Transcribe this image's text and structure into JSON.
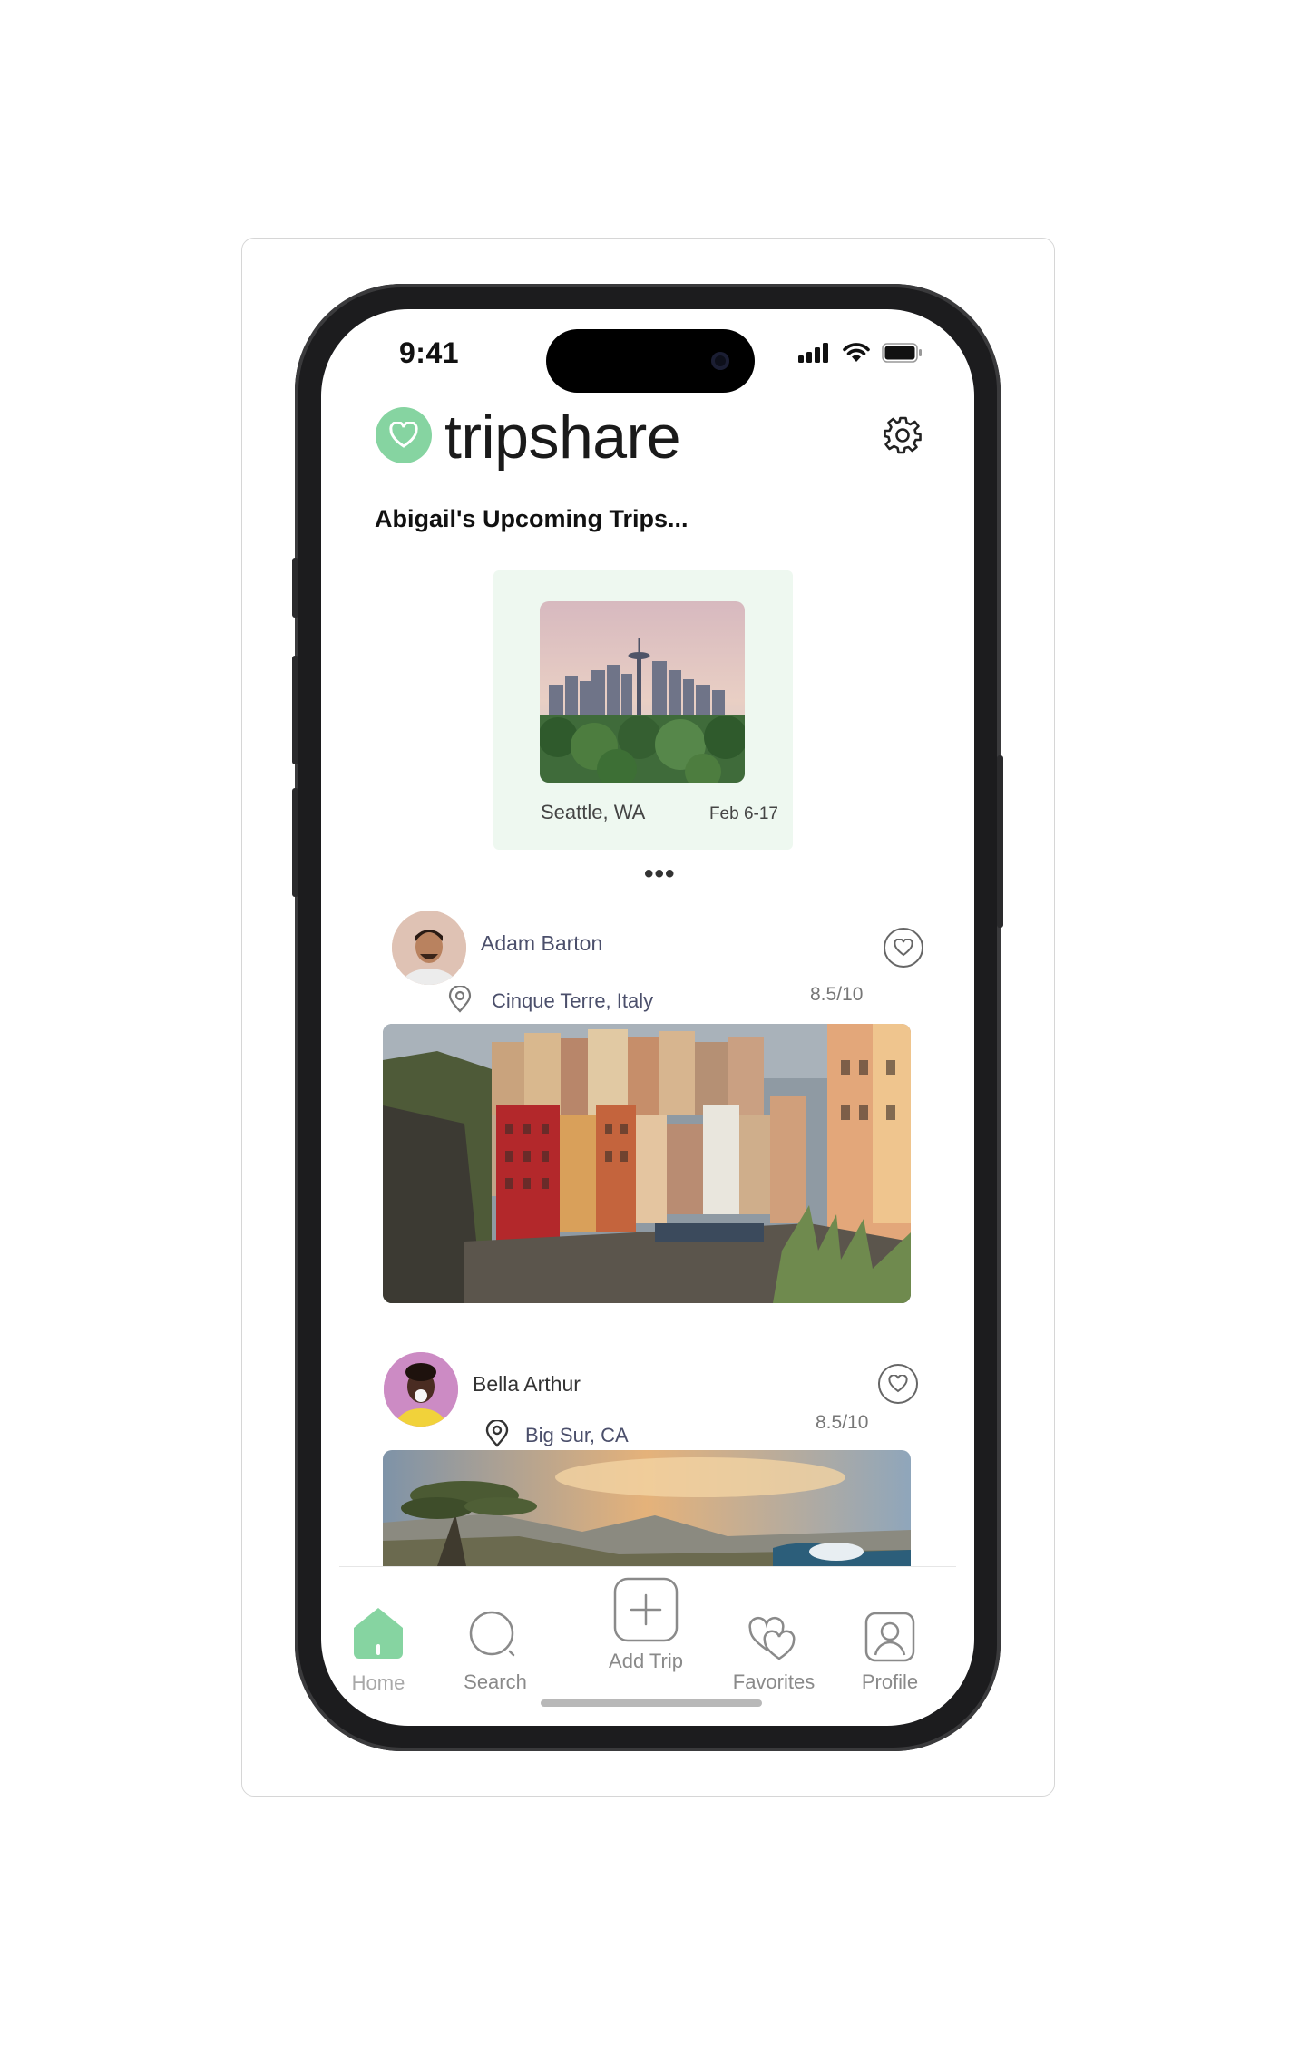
{
  "status_bar": {
    "time": "9:41"
  },
  "header": {
    "brand": "tripshare"
  },
  "upcoming": {
    "title": "Abigail's Upcoming Trips...",
    "trips": [
      {
        "city": "Seattle, WA",
        "dates": "Feb 6-17"
      }
    ],
    "more": "•••"
  },
  "feed": [
    {
      "name": "Adam Barton",
      "location": "Cinque Terre, Italy",
      "rating": "8.5/10"
    },
    {
      "name": "Bella Arthur",
      "location": "Big Sur, CA",
      "rating": "8.5/10"
    }
  ],
  "nav": {
    "home": "Home",
    "search": "Search",
    "add_trip": "Add Trip",
    "favorites": "Favorites",
    "profile": "Profile",
    "active": "home"
  },
  "colors": {
    "accent": "#86d4a1",
    "card_bg": "#eef8f0",
    "name_text": "#4b4f6b"
  },
  "icons": [
    "heart-icon",
    "gear-icon",
    "location-pin-icon",
    "home-icon",
    "search-icon",
    "plus-icon",
    "favorites-icon",
    "profile-icon"
  ]
}
